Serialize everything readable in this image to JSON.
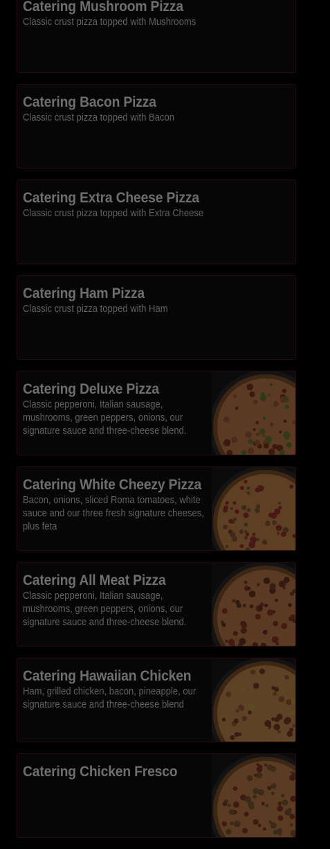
{
  "menu": {
    "items": [
      {
        "title": "Catering Mushroom Pizza",
        "description": "Classic crust pizza topped with Mushrooms",
        "image": null
      },
      {
        "title": "Catering Bacon Pizza",
        "description": "Classic crust pizza topped with Bacon",
        "image": null
      },
      {
        "title": "Catering Extra Cheese Pizza",
        "description": "Classic crust pizza topped with Extra Cheese",
        "image": null
      },
      {
        "title": "Catering Ham Pizza",
        "description": "Classic crust pizza topped with Ham",
        "image": null
      },
      {
        "title": "Catering Deluxe Pizza",
        "description": "Classic pepperoni, Italian sausage, mushrooms, green peppers, onions, our signature sauce and three-cheese blend.",
        "image": "deluxe-pizza-image"
      },
      {
        "title": "Catering White Cheezy Pizza",
        "description": "Bacon, onions, sliced Roma tomatoes, white sauce and our three fresh signature cheeses, plus feta",
        "image": "white-cheezy-pizza-image"
      },
      {
        "title": "Catering All Meat Pizza",
        "description": "Classic pepperoni, Italian sausage, mushrooms, green peppers, onions, our signature sauce and three-cheese blend.",
        "image": "all-meat-pizza-image"
      },
      {
        "title": "Catering Hawaiian Chicken",
        "description": "Ham, grilled chicken, bacon, pineapple, our signature sauce and three-cheese blend",
        "image": "hawaiian-chicken-pizza-image"
      },
      {
        "title": "Catering Chicken Fresco",
        "description": "",
        "image": "chicken-fresco-pizza-image"
      }
    ]
  },
  "colors": {
    "background": "#000000",
    "card_background": "#060606",
    "card_border": "#2a0a0c",
    "title_text": "#6e6e6e",
    "description_text": "#616161"
  }
}
